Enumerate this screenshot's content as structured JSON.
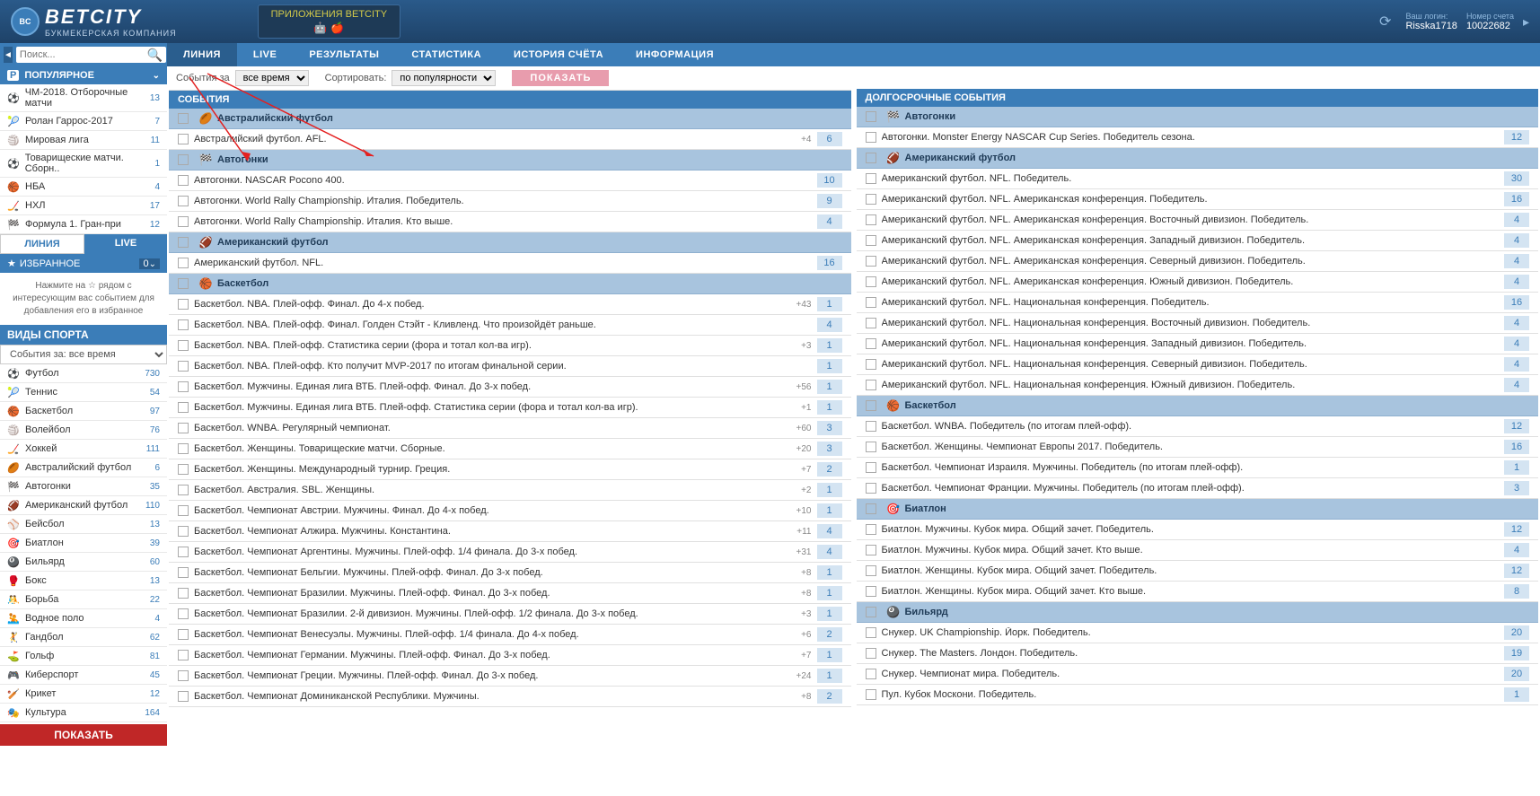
{
  "header": {
    "logo_text": "BETCITY",
    "logo_sub": "БУКМЕКЕРСКАЯ КОМПАНИЯ",
    "app_badge": "ПРИЛОЖЕНИЯ BETCITY",
    "login_label": "Ваш логин:",
    "login_val": "Risska1718",
    "account_label": "Номер счета",
    "account_val": "10022682"
  },
  "search": {
    "placeholder": "Поиск..."
  },
  "nav": {
    "liniya": "ЛИНИЯ",
    "live": "LIVE",
    "results": "РЕЗУЛЬТАТЫ",
    "stats": "СТАТИСТИКА",
    "history": "ИСТОРИЯ СЧЁТА",
    "info": "ИНФОРМАЦИЯ"
  },
  "popular": {
    "title": "ПОПУЛЯРНОЕ",
    "items": [
      {
        "icon": "⚽",
        "name": "ЧМ-2018. Отборочные матчи",
        "count": "13"
      },
      {
        "icon": "🎾",
        "name": "Ролан Гаррос-2017",
        "count": "7"
      },
      {
        "icon": "🏐",
        "name": "Мировая лига",
        "count": "11"
      },
      {
        "icon": "⚽",
        "name": "Товарищеские матчи. Сборн..",
        "count": "1"
      },
      {
        "icon": "🏀",
        "name": "НБА",
        "count": "4"
      },
      {
        "icon": "🏒",
        "name": "НХЛ",
        "count": "17"
      },
      {
        "icon": "🏁",
        "name": "Формула 1. Гран-при",
        "count": "12"
      }
    ]
  },
  "tabs": {
    "liniya": "ЛИНИЯ",
    "live": "LIVE"
  },
  "favorites": {
    "title": "ИЗБРАННОЕ",
    "count": "0",
    "hint": "Нажмите на ☆ рядом с интересующим вас событием для добавления его в избранное"
  },
  "sports": {
    "title": "ВИДЫ СПОРТА",
    "filter": "События за: все время",
    "items": [
      {
        "icon": "⚽",
        "name": "Футбол",
        "count": "730"
      },
      {
        "icon": "🎾",
        "name": "Теннис",
        "count": "54"
      },
      {
        "icon": "🏀",
        "name": "Баскетбол",
        "count": "97"
      },
      {
        "icon": "🏐",
        "name": "Волейбол",
        "count": "76"
      },
      {
        "icon": "🏒",
        "name": "Хоккей",
        "count": "111"
      },
      {
        "icon": "🏉",
        "name": "Австралийский футбол",
        "count": "6"
      },
      {
        "icon": "🏁",
        "name": "Автогонки",
        "count": "35"
      },
      {
        "icon": "🏈",
        "name": "Американский футбол",
        "count": "110"
      },
      {
        "icon": "⚾",
        "name": "Бейсбол",
        "count": "13"
      },
      {
        "icon": "🎯",
        "name": "Биатлон",
        "count": "39"
      },
      {
        "icon": "🎱",
        "name": "Бильярд",
        "count": "60"
      },
      {
        "icon": "🥊",
        "name": "Бокс",
        "count": "13"
      },
      {
        "icon": "🤼",
        "name": "Борьба",
        "count": "22"
      },
      {
        "icon": "🤽",
        "name": "Водное поло",
        "count": "4"
      },
      {
        "icon": "🤾",
        "name": "Гандбол",
        "count": "62"
      },
      {
        "icon": "⛳",
        "name": "Гольф",
        "count": "81"
      },
      {
        "icon": "🎮",
        "name": "Киберспорт",
        "count": "45"
      },
      {
        "icon": "🏏",
        "name": "Крикет",
        "count": "12"
      },
      {
        "icon": "🎭",
        "name": "Культура",
        "count": "164"
      }
    ],
    "show_btn": "ПОКАЗАТЬ"
  },
  "filter_bar": {
    "events_for": "События за",
    "time_opt": "все время",
    "sort": "Сортировать:",
    "sort_opt": "по популярности",
    "show": "ПОКАЗАТЬ"
  },
  "col1": {
    "header": "СОБЫТИЯ",
    "groups": [
      {
        "icon": "🏉",
        "title": "Австралийский футбол",
        "rows": [
          {
            "name": "Австралийский футбол. AFL.",
            "extra": "+4",
            "num": "6"
          }
        ]
      },
      {
        "icon": "🏁",
        "title": "Автогонки",
        "rows": [
          {
            "name": "Автогонки. NASCAR Pocono 400.",
            "num": "10"
          },
          {
            "name": "Автогонки. World Rally Championship. Италия. Победитель.",
            "num": "9"
          },
          {
            "name": "Автогонки. World Rally Championship. Италия. Кто выше.",
            "num": "4"
          }
        ]
      },
      {
        "icon": "🏈",
        "title": "Американский футбол",
        "rows": [
          {
            "name": "Американский футбол. NFL.",
            "num": "16"
          }
        ]
      },
      {
        "icon": "🏀",
        "title": "Баскетбол",
        "rows": [
          {
            "name": "Баскетбол. NBA. Плей-офф. Финал. До 4-х побед.",
            "extra": "+43",
            "num": "1"
          },
          {
            "name": "Баскетбол. NBA. Плей-офф. Финал. Голден Стэйт - Кливленд. Что произойдёт раньше.",
            "num": "4"
          },
          {
            "name": "Баскетбол. NBA. Плей-офф. Статистика серии (фора и тотал кол-ва игр).",
            "extra": "+3",
            "num": "1"
          },
          {
            "name": "Баскетбол. NBA. Плей-офф. Кто получит MVP-2017 по итогам финальной серии.",
            "num": "1"
          },
          {
            "name": "Баскетбол. Мужчины. Единая лига ВТБ. Плей-офф. Финал. До 3-х побед.",
            "extra": "+56",
            "num": "1"
          },
          {
            "name": "Баскетбол. Мужчины. Единая лига ВТБ. Плей-офф. Статистика серии (фора и тотал кол-ва игр).",
            "extra": "+1",
            "num": "1"
          },
          {
            "name": "Баскетбол. WNBA. Регулярный чемпионат.",
            "extra": "+60",
            "num": "3"
          },
          {
            "name": "Баскетбол. Женщины. Товарищеские матчи. Сборные.",
            "extra": "+20",
            "num": "3"
          },
          {
            "name": "Баскетбол. Женщины. Международный турнир. Греция.",
            "extra": "+7",
            "num": "2"
          },
          {
            "name": "Баскетбол. Австралия. SBL. Женщины.",
            "extra": "+2",
            "num": "1"
          },
          {
            "name": "Баскетбол. Чемпионат Австрии. Мужчины. Финал. До 4-х побед.",
            "extra": "+10",
            "num": "1"
          },
          {
            "name": "Баскетбол. Чемпионат Алжира. Мужчины. Константина.",
            "extra": "+11",
            "num": "4"
          },
          {
            "name": "Баскетбол. Чемпионат Аргентины. Мужчины. Плей-офф. 1/4 финала. До 3-х побед.",
            "extra": "+31",
            "num": "4"
          },
          {
            "name": "Баскетбол. Чемпионат Бельгии. Мужчины. Плей-офф. Финал. До 3-х побед.",
            "extra": "+8",
            "num": "1"
          },
          {
            "name": "Баскетбол. Чемпионат Бразилии. Мужчины. Плей-офф. Финал. До 3-х побед.",
            "extra": "+8",
            "num": "1"
          },
          {
            "name": "Баскетбол. Чемпионат Бразилии. 2-й дивизион. Мужчины. Плей-офф. 1/2 финала. До 3-х побед.",
            "extra": "+3",
            "num": "1"
          },
          {
            "name": "Баскетбол. Чемпионат Венесуэлы. Мужчины. Плей-офф. 1/4 финала. До 4-х побед.",
            "extra": "+6",
            "num": "2"
          },
          {
            "name": "Баскетбол. Чемпионат Германии. Мужчины. Плей-офф. Финал. До 3-х побед.",
            "extra": "+7",
            "num": "1"
          },
          {
            "name": "Баскетбол. Чемпионат Греции. Мужчины. Плей-офф. Финал. До 3-х побед.",
            "extra": "+24",
            "num": "1"
          },
          {
            "name": "Баскетбол. Чемпионат Доминиканской Республики. Мужчины.",
            "extra": "+8",
            "num": "2"
          }
        ]
      }
    ]
  },
  "col2": {
    "header": "ДОЛГОСРОЧНЫЕ СОБЫТИЯ",
    "groups": [
      {
        "icon": "🏁",
        "title": "Автогонки",
        "rows": [
          {
            "name": "Автогонки. Monster Energy NASCAR Cup Series. Победитель сезона.",
            "num": "12"
          }
        ]
      },
      {
        "icon": "🏈",
        "title": "Американский футбол",
        "rows": [
          {
            "name": "Американский футбол. NFL. Победитель.",
            "num": "30"
          },
          {
            "name": "Американский футбол. NFL. Американская конференция. Победитель.",
            "num": "16"
          },
          {
            "name": "Американский футбол. NFL. Американская конференция. Восточный дивизион. Победитель.",
            "num": "4"
          },
          {
            "name": "Американский футбол. NFL. Американская конференция. Западный дивизион. Победитель.",
            "num": "4"
          },
          {
            "name": "Американский футбол. NFL. Американская конференция. Северный дивизион. Победитель.",
            "num": "4"
          },
          {
            "name": "Американский футбол. NFL. Американская конференция. Южный дивизион. Победитель.",
            "num": "4"
          },
          {
            "name": "Американский футбол. NFL. Национальная конференция. Победитель.",
            "num": "16"
          },
          {
            "name": "Американский футбол. NFL. Национальная конференция. Восточный дивизион. Победитель.",
            "num": "4"
          },
          {
            "name": "Американский футбол. NFL. Национальная конференция. Западный дивизион. Победитель.",
            "num": "4"
          },
          {
            "name": "Американский футбол. NFL. Национальная конференция. Северный дивизион. Победитель.",
            "num": "4"
          },
          {
            "name": "Американский футбол. NFL. Национальная конференция. Южный дивизион. Победитель.",
            "num": "4"
          }
        ]
      },
      {
        "icon": "🏀",
        "title": "Баскетбол",
        "rows": [
          {
            "name": "Баскетбол. WNBA. Победитель (по итогам плей-офф).",
            "num": "12"
          },
          {
            "name": "Баскетбол. Женщины. Чемпионат Европы 2017. Победитель.",
            "num": "16"
          },
          {
            "name": "Баскетбол. Чемпионат Израиля. Мужчины. Победитель (по итогам плей-офф).",
            "num": "1"
          },
          {
            "name": "Баскетбол. Чемпионат Франции. Мужчины. Победитель (по итогам плей-офф).",
            "num": "3"
          }
        ]
      },
      {
        "icon": "🎯",
        "title": "Биатлон",
        "rows": [
          {
            "name": "Биатлон. Мужчины. Кубок мира. Общий зачет. Победитель.",
            "num": "12"
          },
          {
            "name": "Биатлон. Мужчины. Кубок мира. Общий зачет. Кто выше.",
            "num": "4"
          },
          {
            "name": "Биатлон. Женщины. Кубок мира. Общий зачет. Победитель.",
            "num": "12"
          },
          {
            "name": "Биатлон. Женщины. Кубок мира. Общий зачет. Кто выше.",
            "num": "8"
          }
        ]
      },
      {
        "icon": "🎱",
        "title": "Бильярд",
        "rows": [
          {
            "name": "Снукер. UK Championship. Йорк. Победитель.",
            "num": "20"
          },
          {
            "name": "Снукер. The Masters. Лондон. Победитель.",
            "num": "19"
          },
          {
            "name": "Снукер. Чемпионат мира. Победитель.",
            "num": "20"
          },
          {
            "name": "Пул. Кубок Москони. Победитель.",
            "num": "1"
          }
        ]
      }
    ]
  }
}
